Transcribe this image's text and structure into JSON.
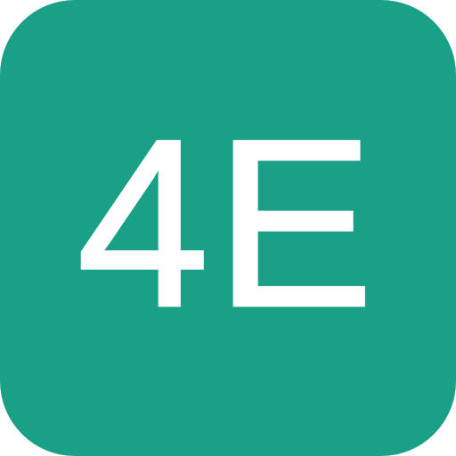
{
  "icon": {
    "text": "4E",
    "background_color": "#19a086",
    "text_color": "#ffffff"
  }
}
